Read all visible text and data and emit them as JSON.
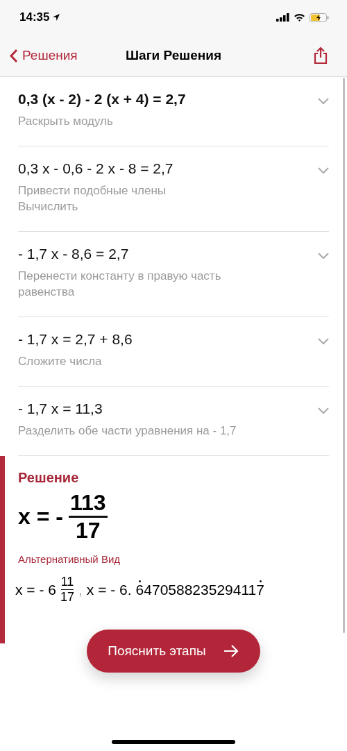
{
  "status_bar": {
    "time": "14:35"
  },
  "nav": {
    "back": "Решения",
    "title": "Шаги Решения"
  },
  "steps": [
    {
      "equation": "0,3 (x - 2) - 2 (x + 4) = 2,7",
      "bold": true,
      "descriptions": [
        "Раскрыть модуль"
      ],
      "expanded": false
    },
    {
      "equation": "0,3 x - 0,6 - 2 x - 8 = 2,7",
      "bold": false,
      "descriptions": [
        "Привести подобные члены",
        "Вычислить"
      ],
      "expanded": false
    },
    {
      "equation": "- 1,7 x - 8,6 = 2,7",
      "bold": false,
      "descriptions": [
        "Перенести константу в правую часть равенства"
      ],
      "expanded": false
    },
    {
      "equation": "- 1,7 x = 2,7 + 8,6",
      "bold": false,
      "descriptions": [
        "Сложите числа"
      ],
      "expanded": false
    },
    {
      "equation": "- 1,7 x = 11,3",
      "bold": false,
      "descriptions": [
        "Разделить обе части уравнения на - 1,7"
      ],
      "expanded": false
    }
  ],
  "solution": {
    "heading": "Решение",
    "lhs": "x = -",
    "numerator": "113",
    "denominator": "17",
    "alt_heading": "Альтернативный Вид",
    "alt_mixed": {
      "lhs": "x = - 6",
      "numerator": "11",
      "denominator": "17"
    },
    "alt_separator": ",",
    "alt_decimal": {
      "lhs": "x = - 6.",
      "repeating": "6470588235294117"
    }
  },
  "explain_button": {
    "label": "Пояснить этапы"
  }
}
